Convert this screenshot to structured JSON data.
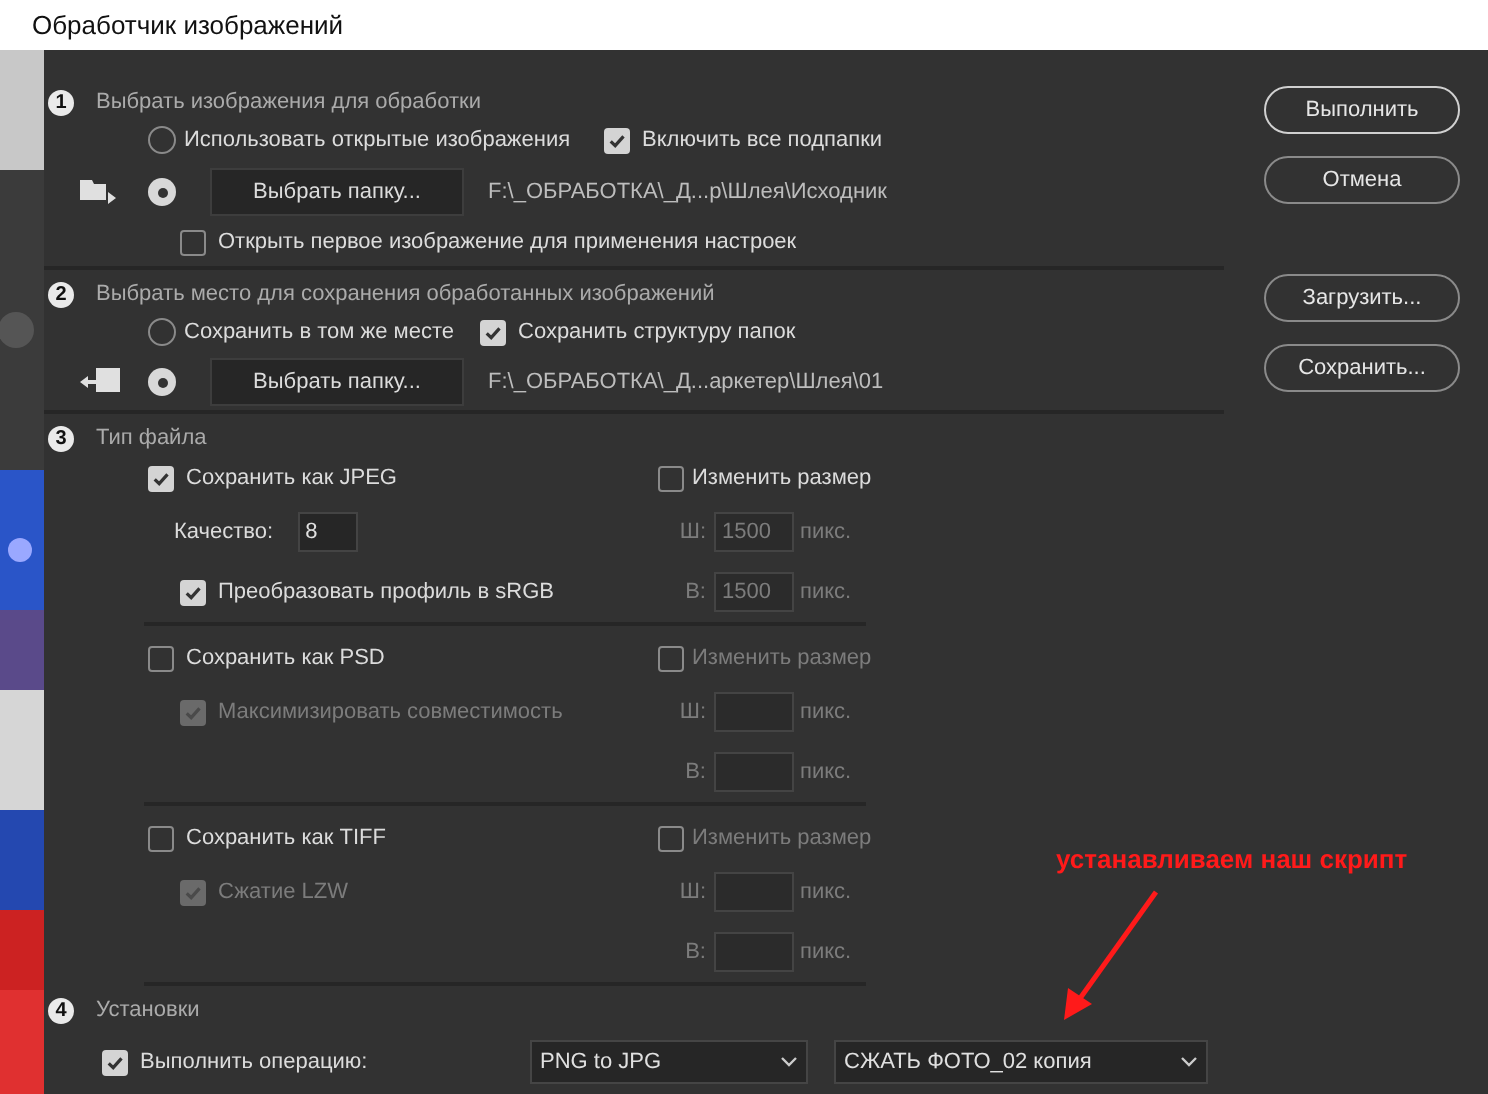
{
  "window": {
    "title": "Обработчик изображений"
  },
  "source": {
    "number": "1",
    "title": "Выбрать изображения для обработки",
    "open_images": {
      "label": "Использовать открытые изображения",
      "selected": false
    },
    "include_subfolders": {
      "label": "Включить все подпапки",
      "checked": true
    },
    "folder": {
      "selected": true,
      "button": "Выбрать папку...",
      "path": "F:\\_ОБРАБОТКА\\_Д...р\\Шлея\\Исходник"
    },
    "open_first": {
      "label": "Открыть первое изображение для применения настроек",
      "checked": false
    }
  },
  "destination": {
    "number": "2",
    "title": "Выбрать место для сохранения обработанных изображений",
    "same_place": {
      "label": "Сохранить в том же месте",
      "selected": false
    },
    "keep_structure": {
      "label": "Сохранить структуру папок",
      "checked": true
    },
    "folder": {
      "selected": true,
      "button": "Выбрать папку...",
      "path": "F:\\_ОБРАБОТКА\\_Д...аркетер\\Шлея\\01"
    }
  },
  "file_type": {
    "number": "3",
    "title": "Тип файла",
    "formats": [
      {
        "label": "Сохранить как JPEG",
        "checked": true,
        "resize": {
          "label": "Изменить размер",
          "checked": false
        },
        "width_label": "Ш:",
        "width_value": "1500",
        "height_label": "В:",
        "height_value": "1500",
        "width_unit": "пикс.",
        "height_unit": "пикс.",
        "options": [
          {
            "kind": "quality",
            "label": "Качество:",
            "value": "8"
          },
          {
            "kind": "checkbox",
            "label": "Преобразовать профиль в sRGB",
            "checked": true
          }
        ]
      },
      {
        "label": "Сохранить как PSD",
        "checked": false,
        "resize": {
          "label": "Изменить размер",
          "checked": false
        },
        "width_label": "Ш:",
        "height_label": "В:",
        "width_unit": "пикс.",
        "height_unit": "пикс.",
        "options": [
          {
            "kind": "checkbox",
            "label": "Максимизировать совместимость",
            "checked": true
          }
        ]
      },
      {
        "label": "Сохранить как TIFF",
        "checked": false,
        "resize": {
          "label": "Изменить размер",
          "checked": false
        },
        "width_label": "Ш:",
        "height_label": "В:",
        "width_unit": "пикс.",
        "height_unit": "пикс.",
        "options": [
          {
            "kind": "checkbox",
            "label": "Сжатие LZW",
            "checked": true
          }
        ]
      }
    ]
  },
  "preferences": {
    "number": "4",
    "title": "Установки",
    "run_action": {
      "label": "Выполнить операцию:",
      "checked": true
    },
    "action_set": "PNG to JPG",
    "action": "СЖАТЬ ФОТО_02 копия"
  },
  "buttons": [
    {
      "label": "Выполнить",
      "default": true
    },
    {
      "label": "Отмена",
      "default": false
    },
    {
      "label": "Загрузить...",
      "default": false
    },
    {
      "label": "Сохранить...",
      "default": false
    }
  ],
  "annotation": {
    "text": "устанавливаем наш скрипт"
  }
}
